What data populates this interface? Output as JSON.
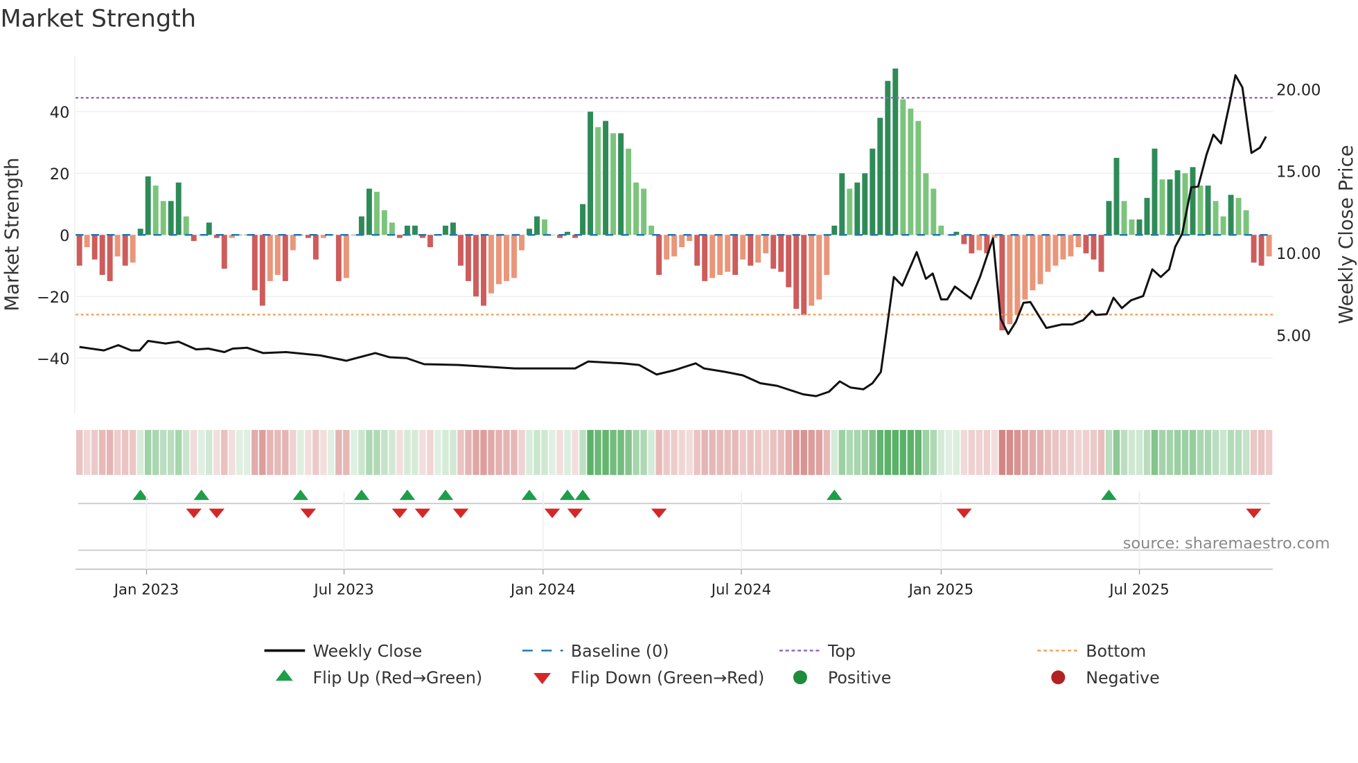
{
  "chart_data": {
    "type": "bar",
    "title": "Market Strength",
    "ylabel": "Market Strength",
    "y2label": "Weekly Close Price",
    "source": "source: sharemaestro.com",
    "ylim": [
      -58,
      58
    ],
    "y2lim": [
      0.2,
      22
    ],
    "yticks": [
      40,
      20,
      0,
      -20,
      -40
    ],
    "ytick_labels": [
      "40",
      "20",
      "0",
      "−20",
      "−40"
    ],
    "y2ticks": [
      20,
      15,
      10,
      5
    ],
    "y2tick_labels": [
      "20.00",
      "15.00",
      "10.00",
      "5.00"
    ],
    "x_unit": "week index",
    "xlim": [
      -0.5,
      156.5
    ],
    "xticks": [
      {
        "label": "Jan 2023",
        "week": 8.8
      },
      {
        "label": "Jul 2023",
        "week": 34.7
      },
      {
        "label": "Jan 2024",
        "week": 60.8
      },
      {
        "label": "Jul 2024",
        "week": 86.8
      },
      {
        "label": "Jan 2025",
        "week": 113
      },
      {
        "label": "Jul 2025",
        "week": 139
      }
    ],
    "top_level": 44.5,
    "bottom_level": -25.9,
    "strength": [
      -10,
      -4,
      -8,
      -13,
      -15,
      -7,
      -10,
      -9,
      2,
      19,
      16,
      11,
      11,
      17,
      6,
      -2,
      0,
      4,
      -1,
      -11,
      -1,
      0,
      0,
      -18,
      -23,
      -15,
      -13,
      -15,
      -5,
      0,
      -1,
      -8,
      -1,
      0,
      -15,
      -14,
      0,
      6,
      15,
      14,
      8,
      4,
      -1,
      3,
      3,
      -1,
      -4,
      0,
      3,
      4,
      -10,
      -15,
      -20,
      -23,
      -19,
      -16,
      -15,
      -14,
      -5,
      2,
      6,
      5,
      0,
      -1,
      1,
      -1,
      10,
      40,
      35,
      37,
      33,
      33,
      28,
      17,
      15,
      3,
      -13,
      -8,
      -7,
      -4,
      -2,
      -10,
      -15,
      -14,
      -13,
      -12,
      -13,
      -8,
      -10,
      -9,
      -6,
      -11,
      -12,
      -17,
      -24,
      -26,
      -23,
      -21,
      -13,
      3,
      20,
      15,
      17,
      20,
      28,
      38,
      50,
      54,
      44,
      41,
      37,
      20,
      15,
      3,
      0,
      1,
      -3,
      -6,
      -5,
      -6,
      -1,
      -31,
      -29,
      -26,
      -21,
      -18,
      -16,
      -12,
      -10,
      -8,
      -7,
      -4,
      -6,
      -8,
      -12,
      11,
      25,
      11,
      5,
      5,
      12,
      28,
      18,
      18,
      21,
      20,
      22,
      16,
      16,
      11,
      6,
      13,
      12,
      8,
      -9,
      -10,
      -7
    ],
    "weekly_close": [
      [
        0,
        4.26
      ],
      [
        3.2,
        4.05
      ],
      [
        5.1,
        4.37
      ],
      [
        6.8,
        4.05
      ],
      [
        7.9,
        4.05
      ],
      [
        9,
        4.63
      ],
      [
        11.3,
        4.47
      ],
      [
        13,
        4.58
      ],
      [
        15.3,
        4.11
      ],
      [
        16.9,
        4.16
      ],
      [
        19,
        3.95
      ],
      [
        20.1,
        4.16
      ],
      [
        22,
        4.21
      ],
      [
        24.1,
        3.89
      ],
      [
        27.1,
        3.95
      ],
      [
        31.6,
        3.74
      ],
      [
        35,
        3.42
      ],
      [
        38.8,
        3.89
      ],
      [
        40.7,
        3.63
      ],
      [
        42.9,
        3.58
      ],
      [
        45.2,
        3.21
      ],
      [
        49.7,
        3.16
      ],
      [
        57.1,
        2.95
      ],
      [
        65,
        2.95
      ],
      [
        66.7,
        3.37
      ],
      [
        71.2,
        3.26
      ],
      [
        73.4,
        3.16
      ],
      [
        75.7,
        2.58
      ],
      [
        78,
        2.84
      ],
      [
        80.8,
        3.26
      ],
      [
        81.9,
        2.95
      ],
      [
        84.7,
        2.74
      ],
      [
        87,
        2.53
      ],
      [
        89.3,
        2.05
      ],
      [
        91.5,
        1.89
      ],
      [
        94.9,
        1.37
      ],
      [
        96.6,
        1.26
      ],
      [
        98.3,
        1.53
      ],
      [
        99.7,
        2.16
      ],
      [
        101.1,
        1.79
      ],
      [
        102.8,
        1.68
      ],
      [
        104,
        2.05
      ],
      [
        105.1,
        2.74
      ],
      [
        105.8,
        5.11
      ],
      [
        106.8,
        8.53
      ],
      [
        107.9,
        8.0
      ],
      [
        109.8,
        10.05
      ],
      [
        111,
        8.42
      ],
      [
        111.9,
        8.74
      ],
      [
        113,
        7.16
      ],
      [
        113.8,
        7.16
      ],
      [
        114.8,
        7.95
      ],
      [
        116.9,
        7.21
      ],
      [
        118.1,
        8.53
      ],
      [
        119.8,
        10.89
      ],
      [
        120.8,
        6.0
      ],
      [
        121.8,
        5.05
      ],
      [
        122.8,
        5.79
      ],
      [
        123.8,
        6.95
      ],
      [
        124.7,
        7.0
      ],
      [
        126.8,
        5.42
      ],
      [
        128.8,
        5.63
      ],
      [
        130.2,
        5.63
      ],
      [
        131.6,
        5.89
      ],
      [
        132.8,
        6.47
      ],
      [
        133.3,
        6.21
      ],
      [
        134.7,
        6.26
      ],
      [
        135.6,
        7.26
      ],
      [
        136.7,
        6.63
      ],
      [
        137.9,
        7.11
      ],
      [
        139.5,
        7.37
      ],
      [
        140.7,
        9.0
      ],
      [
        141.8,
        8.53
      ],
      [
        142.9,
        9.0
      ],
      [
        143.7,
        10.37
      ],
      [
        144.6,
        11.16
      ],
      [
        145.8,
        14.0
      ],
      [
        146.7,
        14.05
      ],
      [
        147.8,
        16.0
      ],
      [
        148.7,
        17.21
      ],
      [
        149.7,
        16.68
      ],
      [
        150.8,
        19.05
      ],
      [
        151.6,
        20.84
      ],
      [
        152.5,
        20.1
      ],
      [
        153.7,
        16.1
      ],
      [
        154.8,
        16.42
      ],
      [
        155.6,
        17.1
      ]
    ],
    "flip_up_weeks": [
      8,
      16,
      29,
      37,
      43,
      48,
      59,
      64,
      66,
      99,
      135
    ],
    "flip_down_weeks": [
      15,
      18,
      30,
      42,
      45,
      50,
      62,
      65,
      76,
      116,
      154
    ],
    "legend": {
      "placement": "bottom",
      "items": [
        {
          "label": "Weekly Close",
          "kind": "line",
          "color": "#111111"
        },
        {
          "label": "Baseline (0)",
          "kind": "dash",
          "color": "#1f77b4"
        },
        {
          "label": "Top",
          "kind": "dot",
          "color": "#9467bd"
        },
        {
          "label": "Bottom",
          "kind": "dot",
          "color": "#f4a460"
        },
        {
          "label": "Flip Up (Red→Green)",
          "kind": "tri-up",
          "color": "#1e9e4a"
        },
        {
          "label": "Flip Down (Green→Red)",
          "kind": "tri-down",
          "color": "#d62728"
        },
        {
          "label": "Positive",
          "kind": "circle",
          "color": "#1e8c3a"
        },
        {
          "label": "Negative",
          "kind": "circle",
          "color": "#b22222"
        }
      ]
    },
    "colors": {
      "pos_strong": "#2e8b57",
      "pos_weak": "#7cc47c",
      "neg_strong": "#cd5c5c",
      "neg_weak": "#e9967a",
      "heat_pos": "#3fa34d",
      "heat_neg": "#c0504d"
    }
  }
}
